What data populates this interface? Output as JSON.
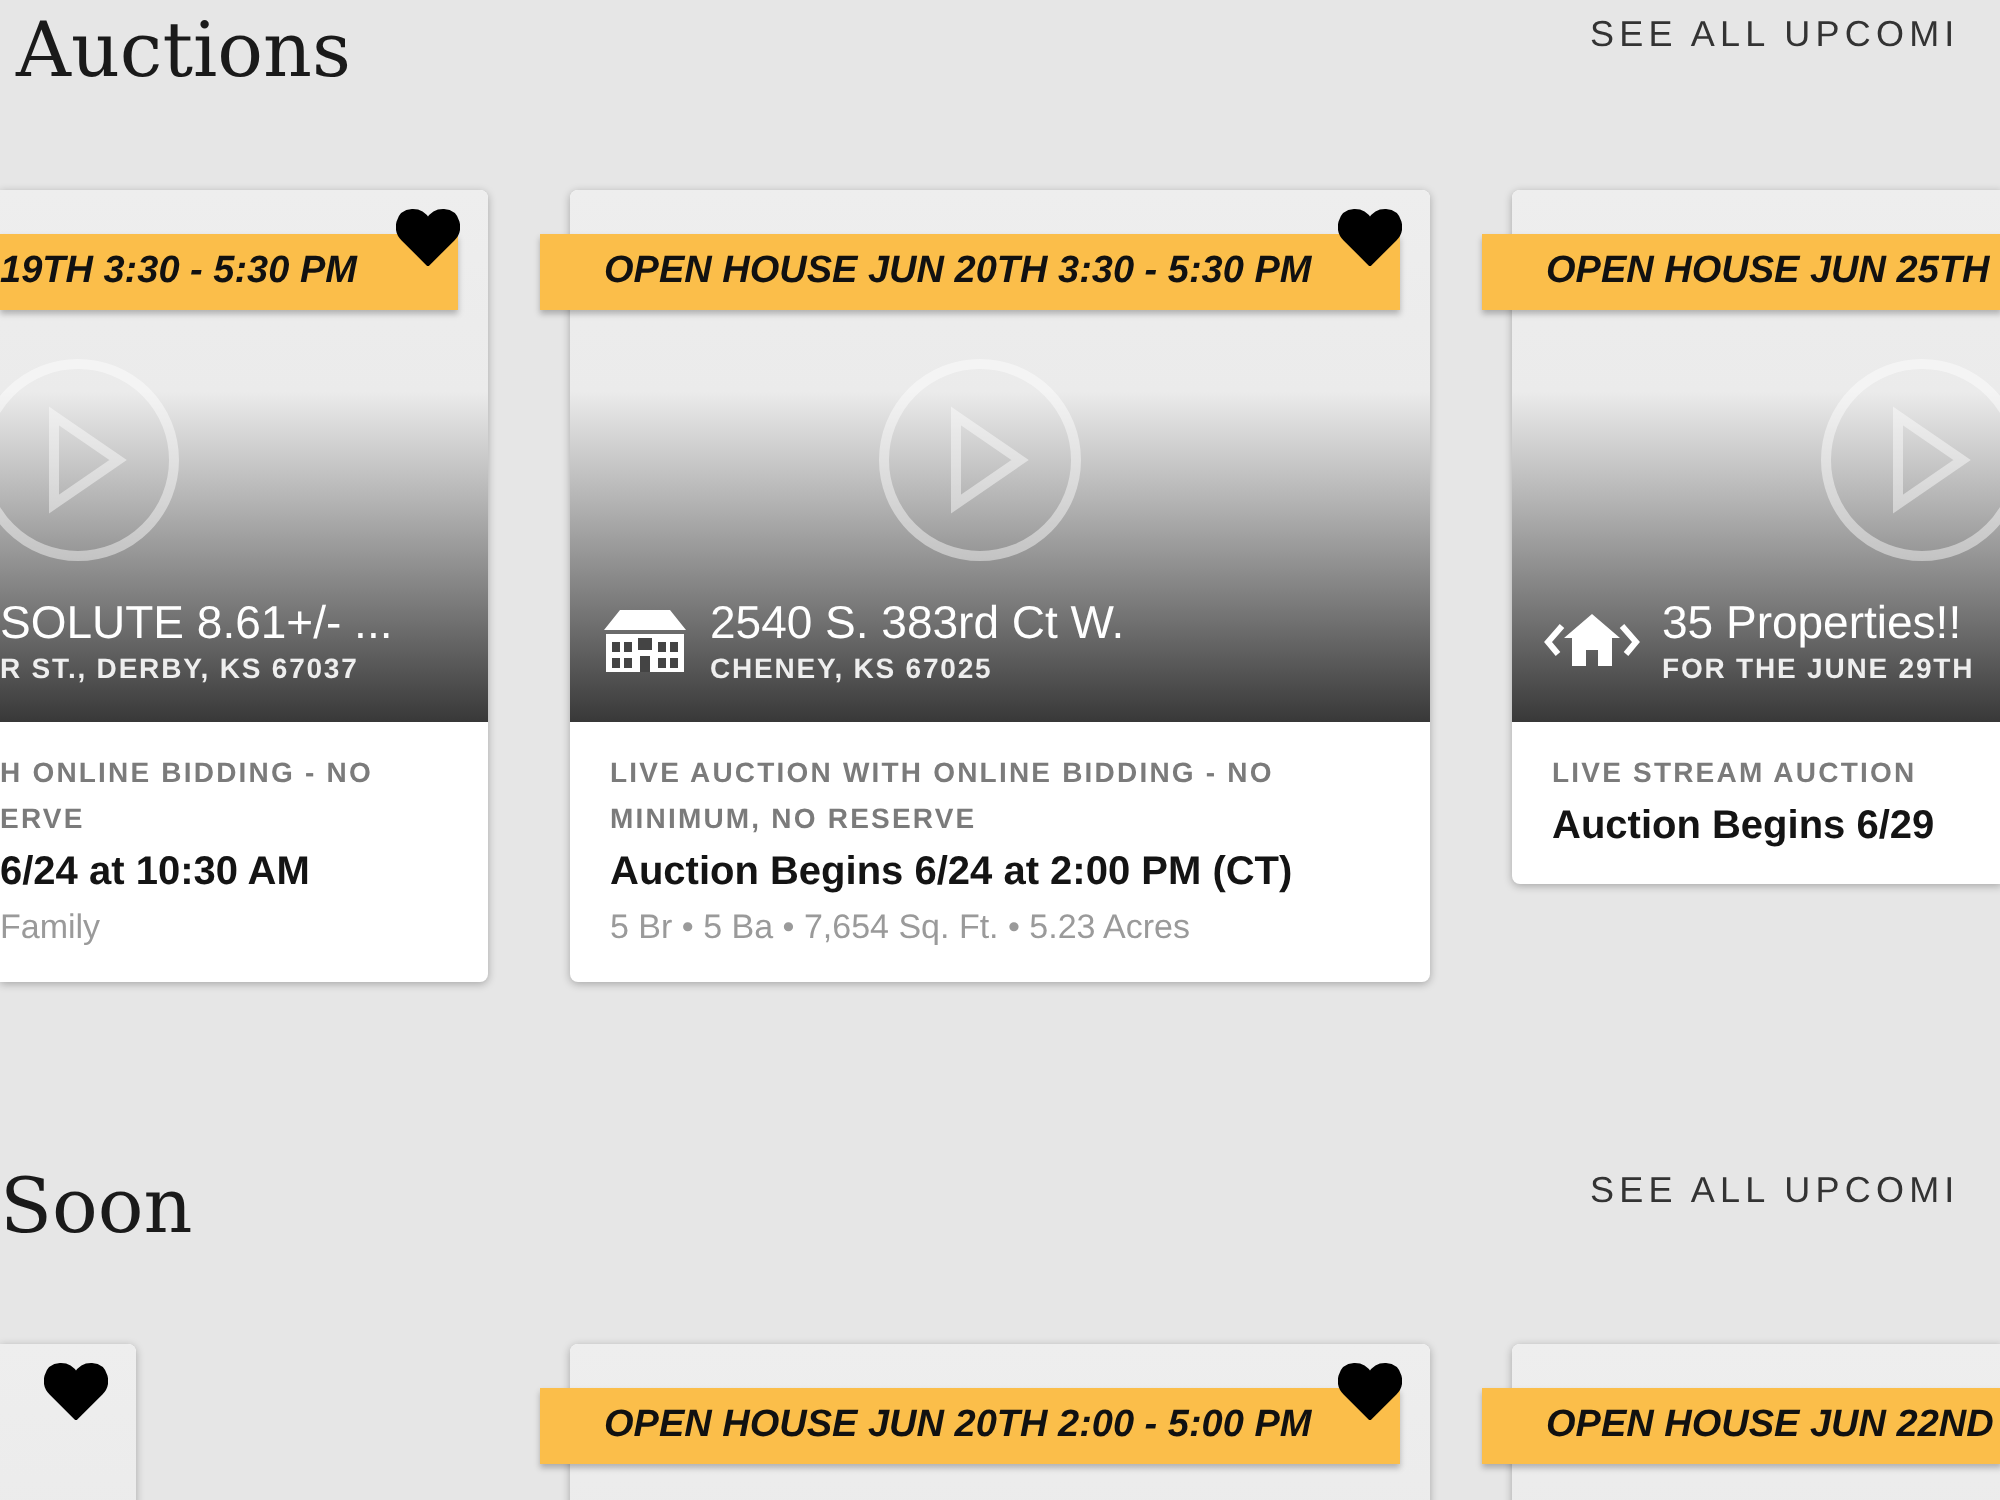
{
  "sections": [
    {
      "title": "Auctions",
      "link": "SEE ALL UPCOMI",
      "cards": [
        {
          "banner": "19TH 3:30 - 5:30 PM",
          "favorite": true,
          "kind": "plain",
          "title": "SOLUTE 8.61+/- ...",
          "location": "R ST., DERBY, KS 67037",
          "type_lines": [
            "H ONLINE BIDDING - NO",
            "ERVE"
          ],
          "date": "6/24 at 10:30 AM",
          "details": "Family"
        },
        {
          "banner": "OPEN HOUSE JUN 20TH 3:30 - 5:30 PM",
          "favorite": true,
          "kind": "single",
          "title": "2540 S. 383rd Ct W.",
          "location": "CHENEY, KS 67025",
          "type_lines": [
            "LIVE AUCTION WITH ONLINE BIDDING - NO",
            "MINIMUM, NO RESERVE"
          ],
          "date": "Auction Begins 6/24 at 2:00 PM (CT)",
          "details": "5 Br • 5 Ba • 7,654 Sq. Ft. • 5.23 Acres"
        },
        {
          "banner": "OPEN HOUSE JUN 25TH",
          "kind": "multi",
          "title": "35 Properties!!",
          "location": "FOR THE JUNE 29TH",
          "type_lines": [
            "LIVE STREAM AUCTION"
          ],
          "date": "Auction Begins 6/29"
        }
      ]
    },
    {
      "title": "Soon",
      "link": "SEE ALL UPCOMI",
      "cards": [
        {
          "favorite": true
        },
        {
          "banner": "OPEN HOUSE JUN 20TH 2:00 - 5:00 PM",
          "favorite": true
        },
        {
          "banner": "OPEN HOUSE JUN 22ND"
        }
      ]
    }
  ]
}
